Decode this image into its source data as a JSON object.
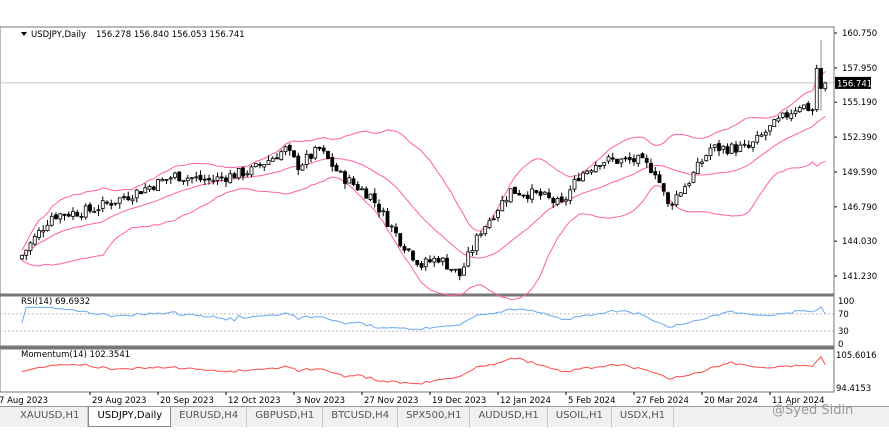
{
  "window": {
    "symbol_header": "USDJPY,Daily",
    "ohlc": "156.278 156.840 156.053 156.741",
    "current_price": "156.741"
  },
  "tabs": [
    {
      "label": "XAUUSD,H1",
      "active": false
    },
    {
      "label": "USDJPY,Daily",
      "active": true
    },
    {
      "label": "EURUSD,H4",
      "active": false
    },
    {
      "label": "GBPUSD,H1",
      "active": false
    },
    {
      "label": "BTCUSD,H4",
      "active": false
    },
    {
      "label": "SPX500,H1",
      "active": false
    },
    {
      "label": "AUDUSD,H1",
      "active": false
    },
    {
      "label": "USOIL,H1",
      "active": false
    },
    {
      "label": "USDX,H1",
      "active": false
    }
  ],
  "watermark": "@Syed Sidin",
  "colors": {
    "bands": "#ff5fa8",
    "rsi": "#6aa8f0",
    "momentum": "#ff4a4a",
    "bull_body": "#ffffff",
    "bear_body": "#000000"
  },
  "chart_data": {
    "type": "candlestick",
    "title": "USDJPY,Daily",
    "bars": 190,
    "close_keypoints": [
      [
        0,
        142.9
      ],
      [
        7,
        146.1
      ],
      [
        16,
        146.5
      ],
      [
        25,
        147.7
      ],
      [
        36,
        149.3
      ],
      [
        44,
        148.9
      ],
      [
        54,
        149.7
      ],
      [
        62,
        151.4
      ],
      [
        65,
        150.1
      ],
      [
        70,
        151.4
      ],
      [
        75,
        149.3
      ],
      [
        82,
        147.7
      ],
      [
        89,
        144.1
      ],
      [
        94,
        142.1
      ],
      [
        98,
        142.7
      ],
      [
        103,
        141.3
      ],
      [
        108,
        144.9
      ],
      [
        115,
        148.1
      ],
      [
        122,
        147.7
      ],
      [
        127,
        146.9
      ],
      [
        131,
        149.3
      ],
      [
        136,
        150.5
      ],
      [
        145,
        150.5
      ],
      [
        149,
        149.7
      ],
      [
        152,
        146.9
      ],
      [
        157,
        148.9
      ],
      [
        162,
        151.5
      ],
      [
        171,
        151.5
      ],
      [
        176,
        153.1
      ],
      [
        183,
        155.0
      ],
      [
        186,
        154.6
      ],
      [
        187,
        157.9
      ],
      [
        188,
        156.3
      ],
      [
        189,
        156.741
      ]
    ],
    "last_bars": [
      {
        "o": 154.6,
        "h": 158.2,
        "l": 154.4,
        "c": 157.9
      },
      {
        "o": 157.9,
        "h": 160.2,
        "l": 154.5,
        "c": 156.3
      },
      {
        "o": 156.278,
        "h": 156.84,
        "l": 156.053,
        "c": 156.741
      }
    ],
    "price_axis": {
      "ticks": [
        "160.750",
        "157.950",
        "155.190",
        "152.390",
        "149.590",
        "146.790",
        "144.030",
        "141.230"
      ],
      "range": [
        141.23,
        160.75
      ]
    },
    "time_axis": {
      "ticks": [
        "7 Aug 2023",
        "29 Aug 2023",
        "20 Sep 2023",
        "12 Oct 2023",
        "3 Nov 2023",
        "27 Nov 2023",
        "19 Dec 2023",
        "12 Jan 2024",
        "5 Feb 2024",
        "27 Feb 2024",
        "20 Mar 2024",
        "11 Apr 2024"
      ],
      "tick_bar_index": [
        0,
        16,
        32,
        48,
        64,
        80,
        96,
        112,
        128,
        144,
        160,
        176
      ]
    },
    "indicators": {
      "bollinger": {
        "period": 20,
        "deviation": 2
      },
      "rsi": {
        "label": "RSI(14) 69.6932",
        "period": 14,
        "levels": [
          "100",
          "70",
          "30",
          "0"
        ]
      },
      "momentum": {
        "label": "Momentum(14) 102.3541",
        "period": 14,
        "ticks": [
          "105.6016",
          "94.4153"
        ],
        "range": [
          94.4153,
          105.6016
        ]
      }
    }
  }
}
